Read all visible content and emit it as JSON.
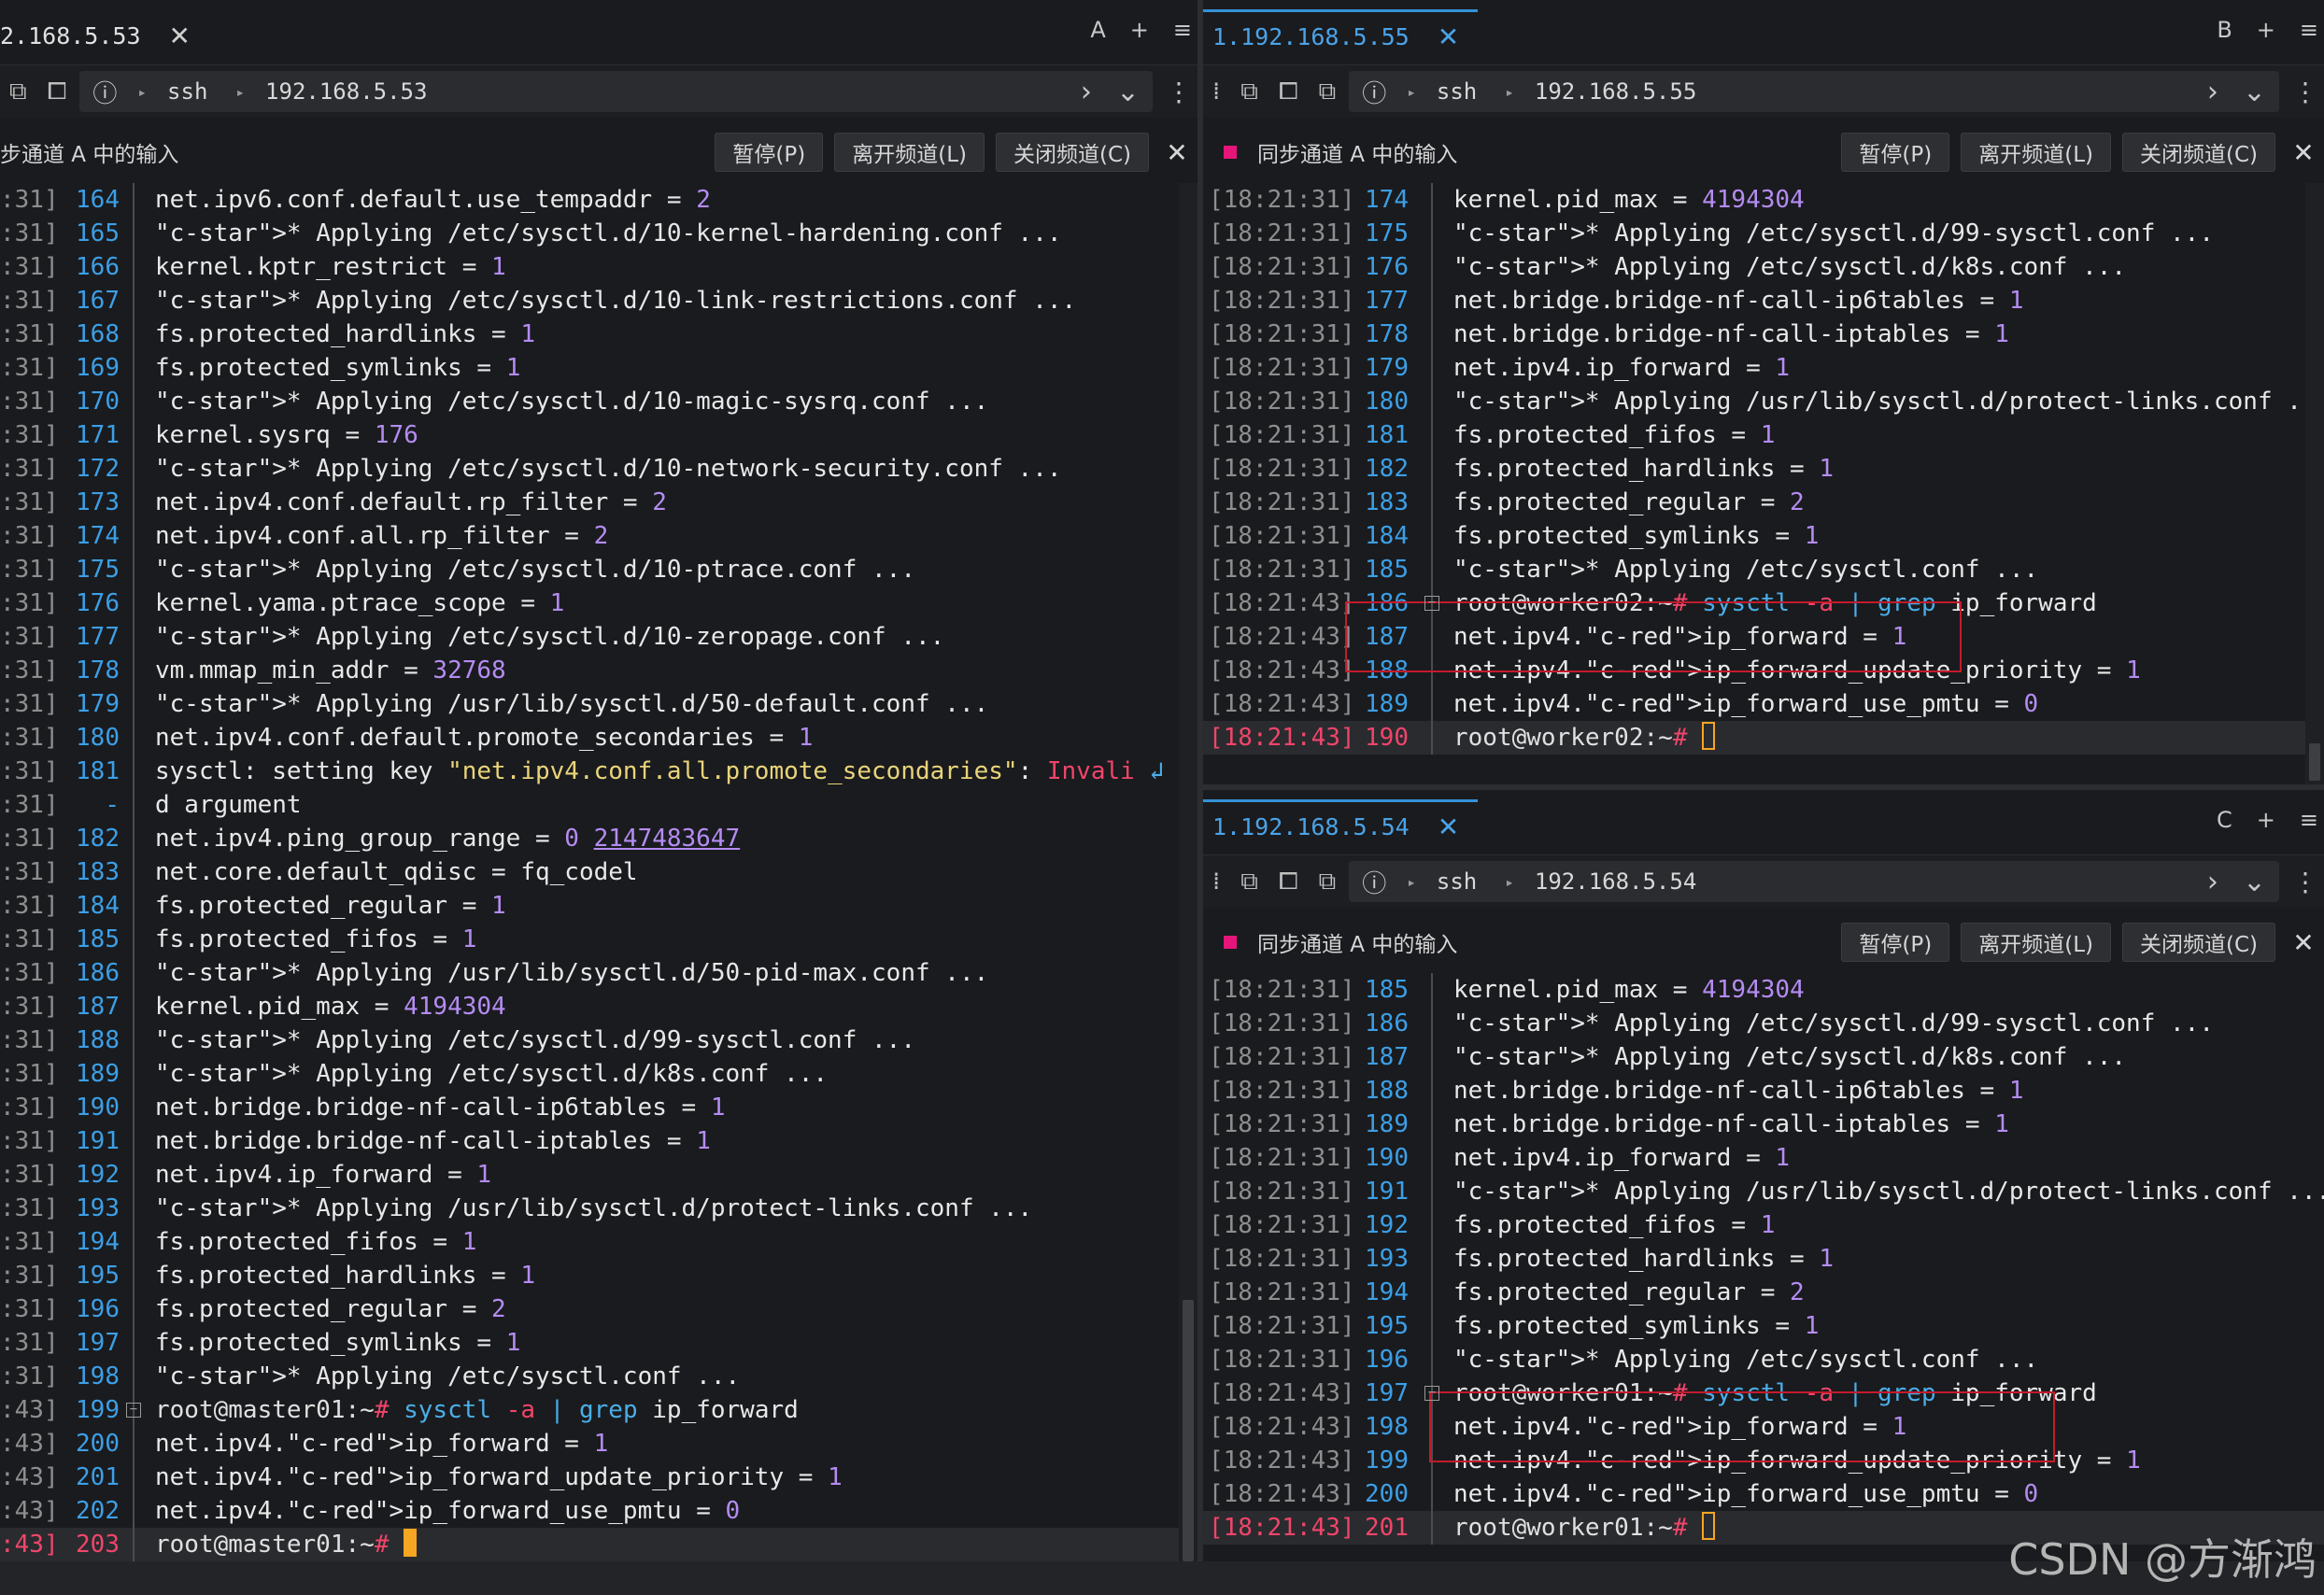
{
  "panes": {
    "left": {
      "tab_title": "2.168.5.53",
      "tab_close": "✕",
      "tab_letter": "A",
      "tab_add": "+",
      "tab_menu": "≡",
      "addr": {
        "proto": "ssh",
        "host": "192.168.5.53"
      },
      "sync_label": "步通道 A 中的输入",
      "buttons": {
        "pause": "暂停(P)",
        "leave": "离开频道(L)",
        "close": "关闭频道(C)"
      }
    },
    "tr": {
      "tab_title": "1.192.168.5.55",
      "tab_close": "✕",
      "tab_letter": "B",
      "tab_add": "+",
      "tab_menu": "≡",
      "addr": {
        "proto": "ssh",
        "host": "192.168.5.55"
      },
      "sync_label": "同步通道 A 中的输入",
      "buttons": {
        "pause": "暂停(P)",
        "leave": "离开频道(L)",
        "close": "关闭频道(C)"
      }
    },
    "br": {
      "tab_title": "1.192.168.5.54",
      "tab_close": "✕",
      "tab_letter": "C",
      "tab_add": "+",
      "tab_menu": "≡",
      "addr": {
        "proto": "ssh",
        "host": "192.168.5.54"
      },
      "sync_label": "同步通道 A 中的输入",
      "buttons": {
        "pause": "暂停(P)",
        "leave": "离开频道(L)",
        "close": "关闭频道(C)"
      }
    }
  },
  "terminal_left": [
    {
      "ts": ":31]",
      "ln": "164",
      "t": "net.ipv6.conf.default.use_tempaddr = 2"
    },
    {
      "ts": ":31]",
      "ln": "165",
      "t": "* Applying /etc/sysctl.d/10-kernel-hardening.conf ..."
    },
    {
      "ts": ":31]",
      "ln": "166",
      "t": "kernel.kptr_restrict = 1"
    },
    {
      "ts": ":31]",
      "ln": "167",
      "t": "* Applying /etc/sysctl.d/10-link-restrictions.conf ..."
    },
    {
      "ts": ":31]",
      "ln": "168",
      "t": "fs.protected_hardlinks = 1"
    },
    {
      "ts": ":31]",
      "ln": "169",
      "t": "fs.protected_symlinks = 1"
    },
    {
      "ts": ":31]",
      "ln": "170",
      "t": "* Applying /etc/sysctl.d/10-magic-sysrq.conf ..."
    },
    {
      "ts": ":31]",
      "ln": "171",
      "t": "kernel.sysrq = 176"
    },
    {
      "ts": ":31]",
      "ln": "172",
      "t": "* Applying /etc/sysctl.d/10-network-security.conf ..."
    },
    {
      "ts": ":31]",
      "ln": "173",
      "t": "net.ipv4.conf.default.rp_filter = 2"
    },
    {
      "ts": ":31]",
      "ln": "174",
      "t": "net.ipv4.conf.all.rp_filter = 2"
    },
    {
      "ts": ":31]",
      "ln": "175",
      "t": "* Applying /etc/sysctl.d/10-ptrace.conf ..."
    },
    {
      "ts": ":31]",
      "ln": "176",
      "t": "kernel.yama.ptrace_scope = 1"
    },
    {
      "ts": ":31]",
      "ln": "177",
      "t": "* Applying /etc/sysctl.d/10-zeropage.conf ..."
    },
    {
      "ts": ":31]",
      "ln": "178",
      "t": "vm.mmap_min_addr = 32768"
    },
    {
      "ts": ":31]",
      "ln": "179",
      "t": "* Applying /usr/lib/sysctl.d/50-default.conf ..."
    },
    {
      "ts": ":31]",
      "ln": "180",
      "t": "net.ipv4.conf.default.promote_secondaries = 1"
    },
    {
      "ts": ":31]",
      "ln": "181",
      "t": "sysctl: setting key \"net.ipv4.conf.all.promote_secondaries\": Invali ↲"
    },
    {
      "ts": ":31]",
      "ln": "-",
      "t": "d argument"
    },
    {
      "ts": ":31]",
      "ln": "182",
      "t": "net.ipv4.ping_group_range = 0 2147483647"
    },
    {
      "ts": ":31]",
      "ln": "183",
      "t": "net.core.default_qdisc = fq_codel"
    },
    {
      "ts": ":31]",
      "ln": "184",
      "t": "fs.protected_regular = 1"
    },
    {
      "ts": ":31]",
      "ln": "185",
      "t": "fs.protected_fifos = 1"
    },
    {
      "ts": ":31]",
      "ln": "186",
      "t": "* Applying /usr/lib/sysctl.d/50-pid-max.conf ..."
    },
    {
      "ts": ":31]",
      "ln": "187",
      "t": "kernel.pid_max = 4194304"
    },
    {
      "ts": ":31]",
      "ln": "188",
      "t": "* Applying /etc/sysctl.d/99-sysctl.conf ..."
    },
    {
      "ts": ":31]",
      "ln": "189",
      "t": "* Applying /etc/sysctl.d/k8s.conf ..."
    },
    {
      "ts": ":31]",
      "ln": "190",
      "t": "net.bridge.bridge-nf-call-ip6tables = 1"
    },
    {
      "ts": ":31]",
      "ln": "191",
      "t": "net.bridge.bridge-nf-call-iptables = 1"
    },
    {
      "ts": ":31]",
      "ln": "192",
      "t": "net.ipv4.ip_forward = 1"
    },
    {
      "ts": ":31]",
      "ln": "193",
      "t": "* Applying /usr/lib/sysctl.d/protect-links.conf ..."
    },
    {
      "ts": ":31]",
      "ln": "194",
      "t": "fs.protected_fifos = 1"
    },
    {
      "ts": ":31]",
      "ln": "195",
      "t": "fs.protected_hardlinks = 1"
    },
    {
      "ts": ":31]",
      "ln": "196",
      "t": "fs.protected_regular = 2"
    },
    {
      "ts": ":31]",
      "ln": "197",
      "t": "fs.protected_symlinks = 1"
    },
    {
      "ts": ":31]",
      "ln": "198",
      "t": "* Applying /etc/sysctl.conf ..."
    },
    {
      "ts": ":43]",
      "ln": "199",
      "t": "root@master01:~# sysctl -a | grep ip_forward"
    },
    {
      "ts": ":43]",
      "ln": "200",
      "t": "net.ipv4.ip_forward = 1"
    },
    {
      "ts": ":43]",
      "ln": "201",
      "t": "net.ipv4.ip_forward_update_priority = 1"
    },
    {
      "ts": ":43]",
      "ln": "202",
      "t": "net.ipv4.ip_forward_use_pmtu = 0"
    },
    {
      "ts": ":43]",
      "ln": "203",
      "t": "root@master01:~# "
    }
  ],
  "terminal_tr": [
    {
      "ts": "[18:21:31]",
      "ln": "174",
      "t": "kernel.pid_max = 4194304"
    },
    {
      "ts": "[18:21:31]",
      "ln": "175",
      "t": "* Applying /etc/sysctl.d/99-sysctl.conf ..."
    },
    {
      "ts": "[18:21:31]",
      "ln": "176",
      "t": "* Applying /etc/sysctl.d/k8s.conf ..."
    },
    {
      "ts": "[18:21:31]",
      "ln": "177",
      "t": "net.bridge.bridge-nf-call-ip6tables = 1"
    },
    {
      "ts": "[18:21:31]",
      "ln": "178",
      "t": "net.bridge.bridge-nf-call-iptables = 1"
    },
    {
      "ts": "[18:21:31]",
      "ln": "179",
      "t": "net.ipv4.ip_forward = 1"
    },
    {
      "ts": "[18:21:31]",
      "ln": "180",
      "t": "* Applying /usr/lib/sysctl.d/protect-links.conf ..."
    },
    {
      "ts": "[18:21:31]",
      "ln": "181",
      "t": "fs.protected_fifos = 1"
    },
    {
      "ts": "[18:21:31]",
      "ln": "182",
      "t": "fs.protected_hardlinks = 1"
    },
    {
      "ts": "[18:21:31]",
      "ln": "183",
      "t": "fs.protected_regular = 2"
    },
    {
      "ts": "[18:21:31]",
      "ln": "184",
      "t": "fs.protected_symlinks = 1"
    },
    {
      "ts": "[18:21:31]",
      "ln": "185",
      "t": "* Applying /etc/sysctl.conf ..."
    },
    {
      "ts": "[18:21:43]",
      "ln": "186",
      "t": "root@worker02:~# sysctl -a | grep ip_forward"
    },
    {
      "ts": "[18:21:43]",
      "ln": "187",
      "t": "net.ipv4.ip_forward = 1"
    },
    {
      "ts": "[18:21:43]",
      "ln": "188",
      "t": "net.ipv4.ip_forward_update_priority = 1"
    },
    {
      "ts": "[18:21:43]",
      "ln": "189",
      "t": "net.ipv4.ip_forward_use_pmtu = 0"
    },
    {
      "ts": "[18:21:43]",
      "ln": "190",
      "t": "root@worker02:~# "
    }
  ],
  "terminal_br": [
    {
      "ts": "[18:21:31]",
      "ln": "185",
      "t": "kernel.pid_max = 4194304"
    },
    {
      "ts": "[18:21:31]",
      "ln": "186",
      "t": "* Applying /etc/sysctl.d/99-sysctl.conf ..."
    },
    {
      "ts": "[18:21:31]",
      "ln": "187",
      "t": "* Applying /etc/sysctl.d/k8s.conf ..."
    },
    {
      "ts": "[18:21:31]",
      "ln": "188",
      "t": "net.bridge.bridge-nf-call-ip6tables = 1"
    },
    {
      "ts": "[18:21:31]",
      "ln": "189",
      "t": "net.bridge.bridge-nf-call-iptables = 1"
    },
    {
      "ts": "[18:21:31]",
      "ln": "190",
      "t": "net.ipv4.ip_forward = 1"
    },
    {
      "ts": "[18:21:31]",
      "ln": "191",
      "t": "* Applying /usr/lib/sysctl.d/protect-links.conf ..."
    },
    {
      "ts": "[18:21:31]",
      "ln": "192",
      "t": "fs.protected_fifos = 1"
    },
    {
      "ts": "[18:21:31]",
      "ln": "193",
      "t": "fs.protected_hardlinks = 1"
    },
    {
      "ts": "[18:21:31]",
      "ln": "194",
      "t": "fs.protected_regular = 2"
    },
    {
      "ts": "[18:21:31]",
      "ln": "195",
      "t": "fs.protected_symlinks = 1"
    },
    {
      "ts": "[18:21:31]",
      "ln": "196",
      "t": "* Applying /etc/sysctl.conf ..."
    },
    {
      "ts": "[18:21:43]",
      "ln": "197",
      "t": "root@worker01:~# sysctl -a | grep ip_forward"
    },
    {
      "ts": "[18:21:43]",
      "ln": "198",
      "t": "net.ipv4.ip_forward = 1"
    },
    {
      "ts": "[18:21:43]",
      "ln": "199",
      "t": "net.ipv4.ip_forward_update_priority = 1"
    },
    {
      "ts": "[18:21:43]",
      "ln": "200",
      "t": "net.ipv4.ip_forward_use_pmtu = 0"
    },
    {
      "ts": "[18:21:43]",
      "ln": "201",
      "t": "root@worker01:~# "
    }
  ],
  "watermark": "CSDN @方渐鸿",
  "colors": {
    "accent": "#3592d8",
    "line_number": "#3c9fe6",
    "highlight_red": "#f0456a",
    "number": "#b48cf2",
    "string": "#ead47a",
    "cursor": "#f5a623",
    "box": "#c41b2c"
  },
  "icons": [
    "new-tab-icon",
    "detach-icon",
    "info-icon",
    "chevron-right-icon",
    "chevron-down-icon",
    "more-icon",
    "close-icon"
  ]
}
